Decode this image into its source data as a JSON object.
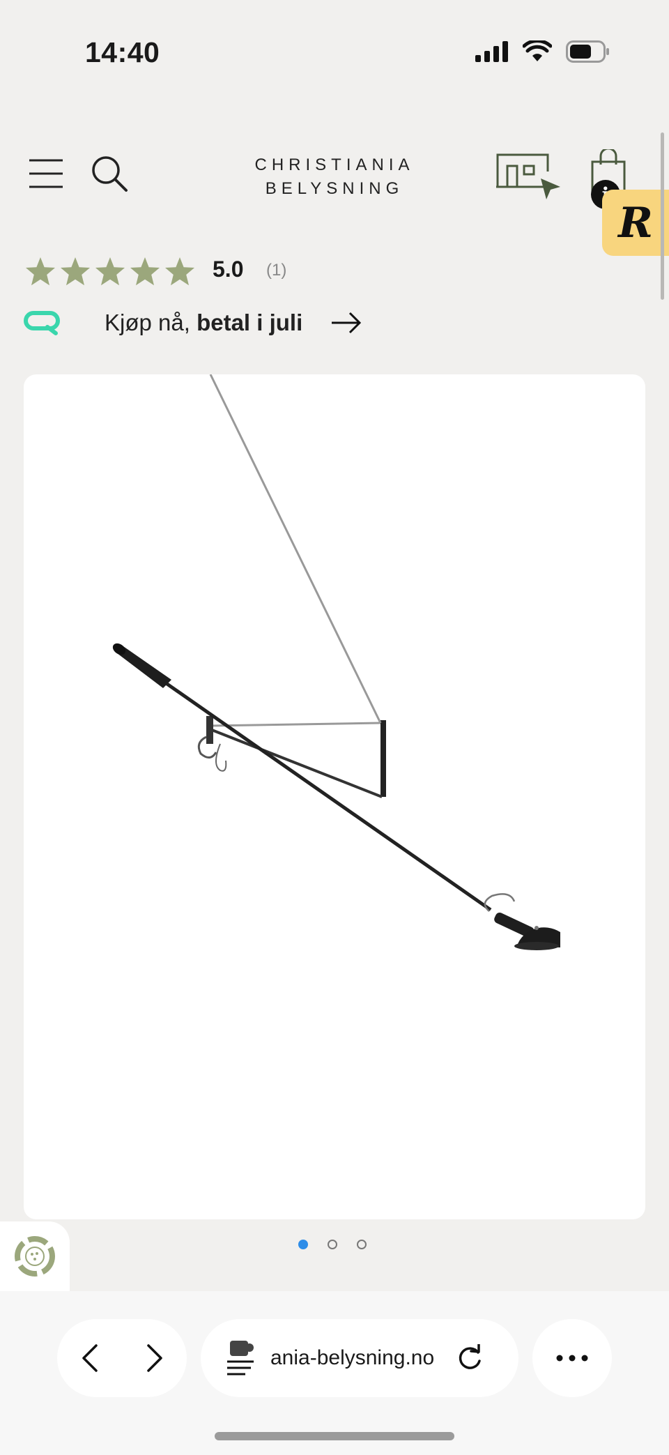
{
  "status_bar": {
    "time": "14:40"
  },
  "header": {
    "logo_line1": "CHRISTIANIA",
    "logo_line2": "BELYSNING",
    "icons": [
      "menu-icon",
      "search-icon",
      "store-icon",
      "cart-icon"
    ],
    "cart_badge": "i",
    "reviews_badge": "R"
  },
  "rating": {
    "stars": 5,
    "value": "5.0",
    "count": "(1)",
    "star_color": "#9ba77c"
  },
  "pay_later": {
    "text_prefix": "Kjøp nå, ",
    "text_bold": "betal i juli"
  },
  "gallery": {
    "total_slides": 3,
    "active_slide": 1,
    "active_color": "#2e8de8"
  },
  "browser": {
    "url": "ania-belysning.no"
  },
  "colors": {
    "background": "#f1f0ee",
    "accent_green": "#4a5a3e",
    "badge_yellow": "#f8d57e",
    "klarna_green": "#3ad6ac"
  }
}
